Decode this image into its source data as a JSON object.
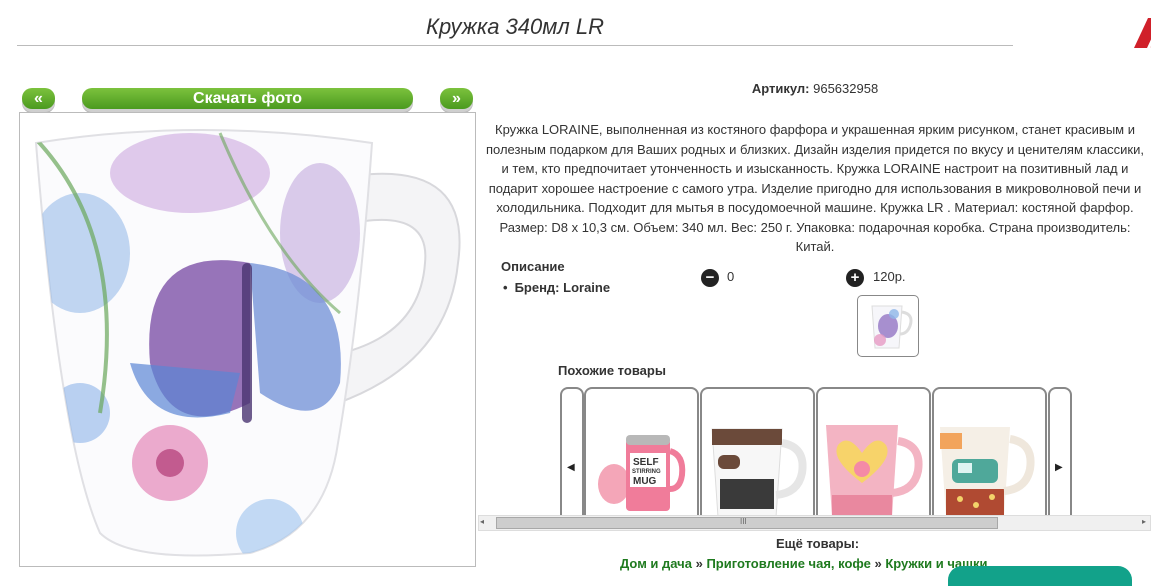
{
  "product": {
    "title": "Кружка 340мл LR",
    "sku_label": "Артикул:",
    "sku_value": "965632958",
    "description": "Кружка LORAINE, выполненная из костяного фарфора и украшенная ярким рисунком, станет красивым и полезным подарком для Ваших родных и близких. Дизайн изделия придется по вкусу и ценителям классики, и тем, кто предпочитает утонченность и изысканность. Кружка LORAINE настроит на позитивный лад и подарит хорошее настроение с самого утра. Изделие пригодно для использования в микроволновой печи и холодильника. Подходит для мытья в посудомоечной машине. Кружка LR . Материал: костяной фарфор. Размер: D8 х 10,3 см. Объем: 340 мл. Вес: 250 г. Упаковка: подарочная коробка. Страна производитель: Китай."
  },
  "gallery": {
    "prev": "«",
    "download": "Скачать фото",
    "next": "»"
  },
  "specs": {
    "title": "Описание",
    "brand": "Бренд: Loraine"
  },
  "order": {
    "minus": "−",
    "plus": "+",
    "quantity": "0",
    "price": "120р."
  },
  "similar": {
    "title": "Похожие товары",
    "prev_arrow": "◀",
    "next_arrow": "▶",
    "items": [
      {
        "print_1": "SELF",
        "print_2": "STIRRING",
        "print_3": "MUG"
      },
      {
        "print_1": "",
        "print_2": "",
        "print_3": ""
      },
      {
        "print_1": "",
        "print_2": "",
        "print_3": ""
      },
      {
        "print_1": "",
        "print_2": "",
        "print_3": ""
      }
    ]
  },
  "scroll": {
    "left": "◂",
    "right": "▸",
    "grip": "III"
  },
  "more": {
    "title": "Ещё товары:",
    "breadcrumb": [
      "Дом и дача",
      "Приготовление чая, кофе",
      "Кружки и чашки"
    ],
    "separator": "»"
  },
  "colors": {
    "accent_green": "#5aa82b",
    "link_green": "#1e7a1e",
    "corner_red": "#d0202a"
  }
}
